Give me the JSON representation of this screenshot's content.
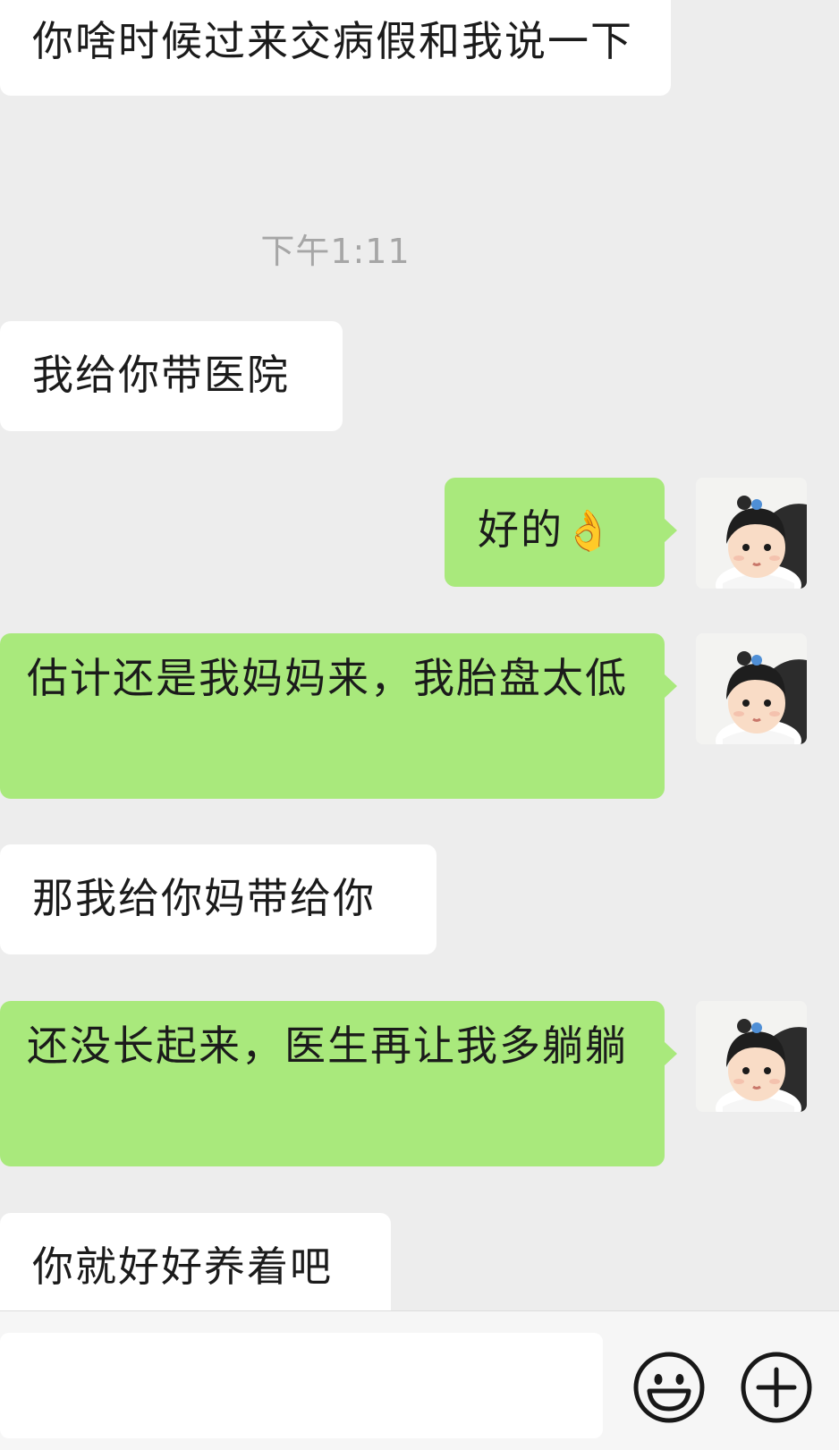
{
  "messages": [
    {
      "direction": "incoming",
      "text": "你啥时候过来交病假和我说一下"
    },
    {
      "direction": "incoming",
      "text": "我给你带医院"
    },
    {
      "direction": "outgoing",
      "text": "好的",
      "emoji": "👌"
    },
    {
      "direction": "outgoing",
      "text": "估计还是我妈妈来，我胎盘太低"
    },
    {
      "direction": "incoming",
      "text": "那我给你妈带给你"
    },
    {
      "direction": "outgoing",
      "text": "还没长起来，医生再让我多躺躺"
    },
    {
      "direction": "incoming",
      "text": "你就好好养着吧"
    }
  ],
  "timestamp": "下午1:11",
  "composer": {
    "input_value": "",
    "emoji_button_icon": "smiley-face-icon",
    "more_button_icon": "plus-circle-icon"
  },
  "colors": {
    "background": "#ededed",
    "incoming_bubble": "#ffffff",
    "outgoing_bubble": "#a9e97c"
  }
}
